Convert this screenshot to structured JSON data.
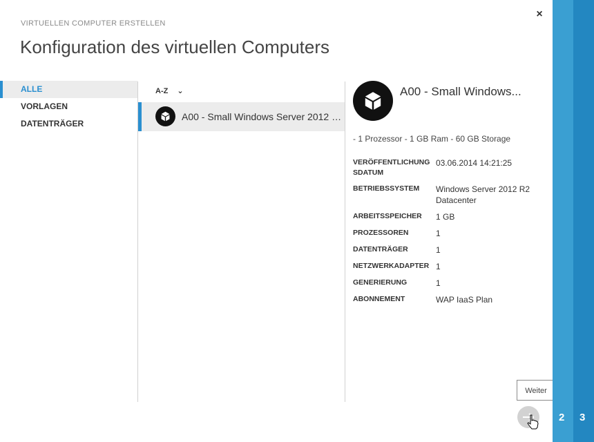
{
  "header": {
    "overline": "VIRTUELLEN COMPUTER ERSTELLEN",
    "title": "Konfiguration des virtuellen Computers",
    "close_label": "×"
  },
  "nav": {
    "items": [
      {
        "label": "ALLE",
        "active": true
      },
      {
        "label": "VORLAGEN",
        "active": false
      },
      {
        "label": "DATENTRÄGER",
        "active": false
      }
    ]
  },
  "list": {
    "sort_label": "A-Z",
    "sort_chevron": "⌄",
    "items": [
      {
        "label": "A00 - Small Windows Server 2012 R...",
        "icon": "cube-icon",
        "selected": true
      }
    ]
  },
  "details": {
    "title": "A00 - Small Windows...",
    "summary": "- 1 Prozessor - 1 GB Ram - 60 GB Storage",
    "properties": [
      {
        "key": "VERÖFFENTLICHUNG SDATUM",
        "value": "03.06.2014 14:21:25"
      },
      {
        "key": "BETRIEBSSYSTEM",
        "value": "Windows Server 2012 R2 Datacenter"
      },
      {
        "key": "ARBEITSSPEICHER",
        "value": "1 GB"
      },
      {
        "key": "PROZESSOREN",
        "value": "1"
      },
      {
        "key": "DATENTRÄGER",
        "value": "1"
      },
      {
        "key": "NETZWERKADAPTER",
        "value": "1"
      },
      {
        "key": "GENERIERUNG",
        "value": "1"
      },
      {
        "key": "ABONNEMENT",
        "value": "WAP IaaS Plan"
      }
    ]
  },
  "footer": {
    "tooltip": "Weiter",
    "next_icon": "arrow-right-icon",
    "steps": [
      "2",
      "3"
    ]
  },
  "colors": {
    "accent": "#2a8fd0",
    "rail_light": "#3a9fd2",
    "rail_dark": "#2387c1"
  }
}
